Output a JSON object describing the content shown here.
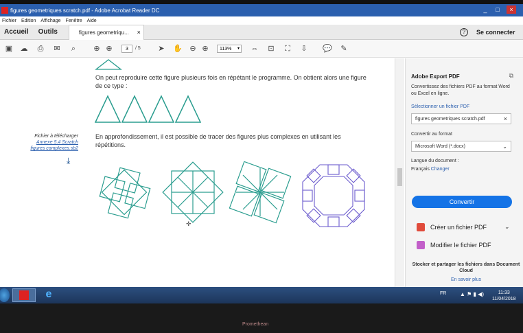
{
  "window": {
    "title": "figures geometriques scratch.pdf - Adobe Acrobat Reader DC",
    "controls": [
      "_",
      "□",
      "×"
    ]
  },
  "menu": [
    "Fichier",
    "Edition",
    "Affichage",
    "Fenêtre",
    "Aide"
  ],
  "tabs": {
    "home": "Accueil",
    "tools": "Outils",
    "document": "figures geometriqu...",
    "close": "×",
    "help": "?",
    "signin": "Se connecter"
  },
  "toolbar": {
    "page_current": "3",
    "page_total": "/ 5",
    "zoom": "113%"
  },
  "document": {
    "para1": "On peut reproduire cette figure plusieurs fois en répétant le programme. On obtient alors une figure de ce type :",
    "para2": "En approfondissement, il est possible de tracer des figures plus complexes en utilisant les répétitions.",
    "sidenote_title": "Fichier à télécharger",
    "sidenote_link": "Annexe 5.4 Scratch figures complexes.sb2"
  },
  "panel": {
    "title": "Adobe Export PDF",
    "desc": "Convertissez des fichiers PDF au format Word ou Excel en ligne.",
    "select_link": "Sélectionner un fichier PDF",
    "file_value": "figures geometriques scratch.pdf",
    "convert_label": "Convertir au format",
    "format_value": "Microsoft Word (*.docx)",
    "lang_label": "Langue du document :",
    "lang_value": "Français",
    "lang_change": "Changer",
    "convert_button": "Convertir",
    "create_pdf": "Créer un fichier PDF",
    "edit_pdf": "Modifier le fichier PDF",
    "cloud_text": "Stocker et partager les fichiers dans Document Cloud",
    "learn_more": "En savoir plus"
  },
  "taskbar": {
    "lang": "FR",
    "time": "11:33",
    "date": "11/04/2018"
  },
  "bezel": {
    "brand": "Promethean"
  },
  "colors": {
    "accent": "#1473e6",
    "figure": "#2a9d8f",
    "figure_alt": "#6a5acd"
  }
}
